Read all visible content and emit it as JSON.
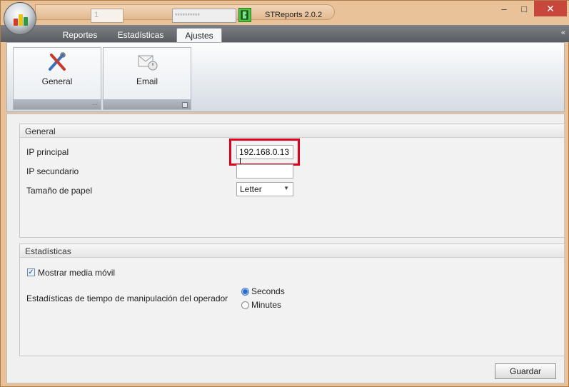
{
  "window": {
    "title": "STReports 2.0.2",
    "page_field": "1",
    "password_field": "**********",
    "controls": {
      "minimize": "–",
      "maximize": "□",
      "close": "✕"
    }
  },
  "ribbon": {
    "tabs": [
      {
        "label": "Reportes"
      },
      {
        "label": "Estadísticas"
      },
      {
        "label": "Ajustes"
      }
    ],
    "collapse_icon": "«",
    "groups": [
      {
        "label": "General",
        "icon": "tools-icon"
      },
      {
        "label": "Email",
        "icon": "email-icon"
      }
    ]
  },
  "general": {
    "header": "General",
    "ip_principal_label": "IP principal",
    "ip_principal_value": "192.168.0.13",
    "ip_secundario_label": "IP secundario",
    "ip_secundario_value": "",
    "paper_label": "Tamaño de papel",
    "paper_value": "Letter"
  },
  "estadisticas": {
    "header": "Estadísticas",
    "moving_avg_label": "Mostrar media móvil",
    "moving_avg_checked": true,
    "operator_time_label": "Estadísticas de tiempo de manipulación del operador",
    "options": [
      {
        "label": "Seconds",
        "selected": true
      },
      {
        "label": "Minutes",
        "selected": false
      }
    ]
  },
  "footer": {
    "save_label": "Guardar"
  },
  "colors": {
    "highlight": "#e0001a",
    "accent": "#2c6cc4",
    "exit_button": "#4cc43f"
  }
}
